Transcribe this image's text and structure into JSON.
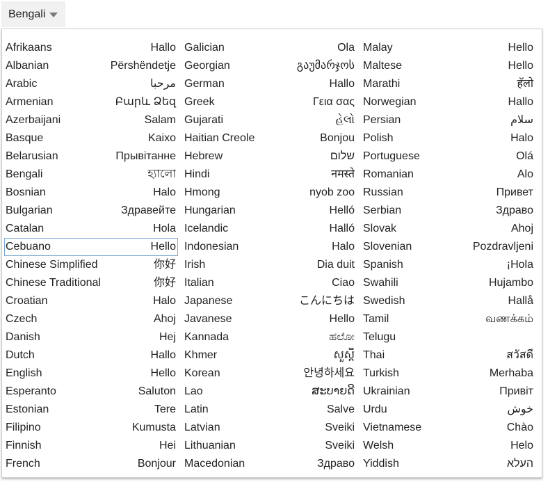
{
  "selector": {
    "selected": "Bengali"
  },
  "highlighted": "Cebuano",
  "columns": [
    [
      {
        "name": "Afrikaans",
        "greeting": "Hallo"
      },
      {
        "name": "Albanian",
        "greeting": "Përshëndetje"
      },
      {
        "name": "Arabic",
        "greeting": "مرحبا"
      },
      {
        "name": "Armenian",
        "greeting": "Բարև Ձեզ"
      },
      {
        "name": "Azerbaijani",
        "greeting": "Salam"
      },
      {
        "name": "Basque",
        "greeting": "Kaixo"
      },
      {
        "name": "Belarusian",
        "greeting": "Прывітанне"
      },
      {
        "name": "Bengali",
        "greeting": "হ্যালো"
      },
      {
        "name": "Bosnian",
        "greeting": "Halo"
      },
      {
        "name": "Bulgarian",
        "greeting": "Здравейте"
      },
      {
        "name": "Catalan",
        "greeting": "Hola"
      },
      {
        "name": "Cebuano",
        "greeting": "Hello"
      },
      {
        "name": "Chinese Simplified",
        "greeting": "你好"
      },
      {
        "name": "Chinese Traditional",
        "greeting": "你好"
      },
      {
        "name": "Croatian",
        "greeting": "Halo"
      },
      {
        "name": "Czech",
        "greeting": "Ahoj"
      },
      {
        "name": "Danish",
        "greeting": "Hej"
      },
      {
        "name": "Dutch",
        "greeting": "Hallo"
      },
      {
        "name": "English",
        "greeting": "Hello"
      },
      {
        "name": "Esperanto",
        "greeting": "Saluton"
      },
      {
        "name": "Estonian",
        "greeting": "Tere"
      },
      {
        "name": "Filipino",
        "greeting": "Kumusta"
      },
      {
        "name": "Finnish",
        "greeting": "Hei"
      },
      {
        "name": "French",
        "greeting": "Bonjour"
      }
    ],
    [
      {
        "name": "Galician",
        "greeting": "Ola"
      },
      {
        "name": "Georgian",
        "greeting": "გაუმარჯოს"
      },
      {
        "name": "German",
        "greeting": "Hallo"
      },
      {
        "name": "Greek",
        "greeting": "Γεια σας"
      },
      {
        "name": "Gujarati",
        "greeting": "હેલો"
      },
      {
        "name": "Haitian Creole",
        "greeting": "Bonjou"
      },
      {
        "name": "Hebrew",
        "greeting": "שלום"
      },
      {
        "name": "Hindi",
        "greeting": "नमस्ते"
      },
      {
        "name": "Hmong",
        "greeting": "nyob zoo"
      },
      {
        "name": "Hungarian",
        "greeting": "Helló"
      },
      {
        "name": "Icelandic",
        "greeting": "Halló"
      },
      {
        "name": "Indonesian",
        "greeting": "Halo"
      },
      {
        "name": "Irish",
        "greeting": "Dia duit"
      },
      {
        "name": "Italian",
        "greeting": "Ciao"
      },
      {
        "name": "Japanese",
        "greeting": "こんにちは"
      },
      {
        "name": "Javanese",
        "greeting": "Hello"
      },
      {
        "name": "Kannada",
        "greeting": "ಹಲೋ"
      },
      {
        "name": "Khmer",
        "greeting": "សួស្តី"
      },
      {
        "name": "Korean",
        "greeting": "안녕하세요"
      },
      {
        "name": "Lao",
        "greeting": "ສະບາຍດີ"
      },
      {
        "name": "Latin",
        "greeting": "Salve"
      },
      {
        "name": "Latvian",
        "greeting": "Sveiki"
      },
      {
        "name": "Lithuanian",
        "greeting": "Sveiki"
      },
      {
        "name": "Macedonian",
        "greeting": "Здраво"
      }
    ],
    [
      {
        "name": "Malay",
        "greeting": "Hello"
      },
      {
        "name": "Maltese",
        "greeting": "Hello"
      },
      {
        "name": "Marathi",
        "greeting": "हॅलो"
      },
      {
        "name": "Norwegian",
        "greeting": "Hallo"
      },
      {
        "name": "Persian",
        "greeting": "سلام"
      },
      {
        "name": "Polish",
        "greeting": "Halo"
      },
      {
        "name": "Portuguese",
        "greeting": "Olá"
      },
      {
        "name": "Romanian",
        "greeting": "Alo"
      },
      {
        "name": "Russian",
        "greeting": "Привет"
      },
      {
        "name": "Serbian",
        "greeting": "Здраво"
      },
      {
        "name": "Slovak",
        "greeting": "Ahoj"
      },
      {
        "name": "Slovenian",
        "greeting": "Pozdravljeni"
      },
      {
        "name": "Spanish",
        "greeting": "¡Hola"
      },
      {
        "name": "Swahili",
        "greeting": "Hujambo"
      },
      {
        "name": "Swedish",
        "greeting": "Hallå"
      },
      {
        "name": "Tamil",
        "greeting": "வணக்கம்"
      },
      {
        "name": "Telugu",
        "greeting": ""
      },
      {
        "name": "Thai",
        "greeting": "สวัสดี"
      },
      {
        "name": "Turkish",
        "greeting": "Merhaba"
      },
      {
        "name": "Ukrainian",
        "greeting": "Привіт"
      },
      {
        "name": "Urdu",
        "greeting": "خوش"
      },
      {
        "name": "Vietnamese",
        "greeting": "Chào"
      },
      {
        "name": "Welsh",
        "greeting": "Helo"
      },
      {
        "name": "Yiddish",
        "greeting": "העלא"
      }
    ]
  ]
}
